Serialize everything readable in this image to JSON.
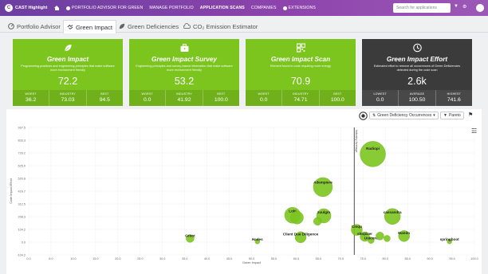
{
  "header": {
    "app_title": "CAST Highlight",
    "nav": [
      {
        "label": "PORTFOLIO ADVISOR FOR GREEN",
        "active": false
      },
      {
        "label": "MANAGE PORTFOLIO",
        "active": false
      },
      {
        "label": "APPLICATION SCANS",
        "active": true
      },
      {
        "label": "COMPANIES",
        "active": false
      },
      {
        "label": "EXTENSIONS",
        "active": false
      }
    ],
    "search_placeholder": "Search for applications"
  },
  "tabs": [
    {
      "label": "Portfolio Advisor",
      "icon": "gauge-icon",
      "active": false
    },
    {
      "label": "Green Impact",
      "icon": "handshake-icon",
      "active": true
    },
    {
      "label": "Green Deficiencies",
      "icon": "leaf-icon",
      "active": false
    },
    {
      "label": "CO₂ Emission Estimator",
      "icon": "cloud-icon",
      "active": false
    }
  ],
  "cards": [
    {
      "title": "Green Impact",
      "icon": "leaf-icon",
      "description": "Programming practices and engineering principles that make software more environment friendly",
      "value": "72.2",
      "worst_label": "WORST",
      "worst": "36.2",
      "mid_label": "INDUSTRY",
      "mid": "73.03",
      "best_label": "BEST",
      "best": "94.5",
      "color": "#7cc51f"
    },
    {
      "title": "Green Impact Survey",
      "icon": "briefcase-icon",
      "description": "Engineering principles and survey-based information that make software more environment friendly",
      "value": "53.2",
      "worst_label": "WORST",
      "worst": "0.0",
      "mid_label": "INDUSTRY",
      "mid": "41.92",
      "best_label": "BEST",
      "best": "100.0",
      "color": "#7cc51f"
    },
    {
      "title": "Green Impact Scan",
      "icon": "qr-code-icon",
      "description": "Element found in code requiring more energy",
      "value": "70.9",
      "worst_label": "WORST",
      "worst": "0.0",
      "mid_label": "INDUSTRY",
      "mid": "74.71",
      "best_label": "BEST",
      "best": "100.0",
      "color": "#7cc51f"
    },
    {
      "title": "Green Impact Effort",
      "icon": "clock-icon",
      "description": "Estimated effort to remove all occurrences of Green Deficiencies detected during the code scan",
      "value": "2.6k",
      "worst_label": "LOWEST",
      "worst": "0.0",
      "mid_label": "AVERAGE",
      "mid": "100.50",
      "best_label": "HIGHEST",
      "best": "741.6",
      "color": "#3b3b3b"
    }
  ],
  "toolbar": {
    "metric_select": "Green Deficiency Occurrences",
    "pareto_label": "Pareto"
  },
  "chart_data": {
    "type": "scatter",
    "xlabel": "Green Impact",
    "ylabel": "Code Impact Effort",
    "xlim": [
      0,
      100
    ],
    "ylim": [
      -104.2,
      937.5
    ],
    "xticks": [
      "0.0",
      "5.0",
      "10.0",
      "15.0",
      "20.0",
      "25.0",
      "30.0",
      "35.0",
      "40.0",
      "45.0",
      "50.0",
      "55.0",
      "60.0",
      "65.0",
      "70.0",
      "75.0",
      "80.0",
      "85.0",
      "90.0",
      "95.0",
      "100.0"
    ],
    "yticks": [
      "937.5",
      "833.3",
      "729.2",
      "625.0",
      "520.8",
      "416.7",
      "312.5",
      "208.3",
      "104.2",
      "0.0",
      "-104.2"
    ],
    "reference_line": {
      "x": 73.03,
      "label": "Industry Average"
    },
    "bubble_color": "#7cc51f",
    "points": [
      {
        "name": "Radiopi",
        "x": 77.2,
        "y": 720,
        "size": 16
      },
      {
        "name": "Adempiere",
        "x": 66.0,
        "y": 450,
        "size": 12
      },
      {
        "name": "Loki",
        "x": 59.2,
        "y": 220,
        "size": 10
      },
      {
        "name": "",
        "x": 60.2,
        "y": 200,
        "size": 8
      },
      {
        "name": "zuulgm",
        "x": 66.2,
        "y": 215,
        "size": 9
      },
      {
        "name": "",
        "x": 64.8,
        "y": 170,
        "size": 5
      },
      {
        "name": "cassandra",
        "x": 81.6,
        "y": 210,
        "size": 10
      },
      {
        "name": "Client Due Diligence",
        "x": 61.0,
        "y": 40,
        "size": 7
      },
      {
        "name": "Cinqu",
        "x": 73.6,
        "y": 100,
        "size": 7
      },
      {
        "name": "shopizer",
        "x": 75.4,
        "y": 45,
        "size": 6
      },
      {
        "name": "Unicore",
        "x": 76.8,
        "y": 15,
        "size": 4
      },
      {
        "name": "",
        "x": 78.8,
        "y": 50,
        "size": 5
      },
      {
        "name": "",
        "x": 80.4,
        "y": 30,
        "size": 4
      },
      {
        "name": "Mando",
        "x": 84.2,
        "y": 50,
        "size": 7
      },
      {
        "name": "Groot",
        "x": 36.2,
        "y": 30,
        "size": 5
      },
      {
        "name": "Hades",
        "x": 51.3,
        "y": 5,
        "size": 3
      },
      {
        "name": "springboot",
        "x": 94.4,
        "y": 5,
        "size": 3
      }
    ]
  }
}
